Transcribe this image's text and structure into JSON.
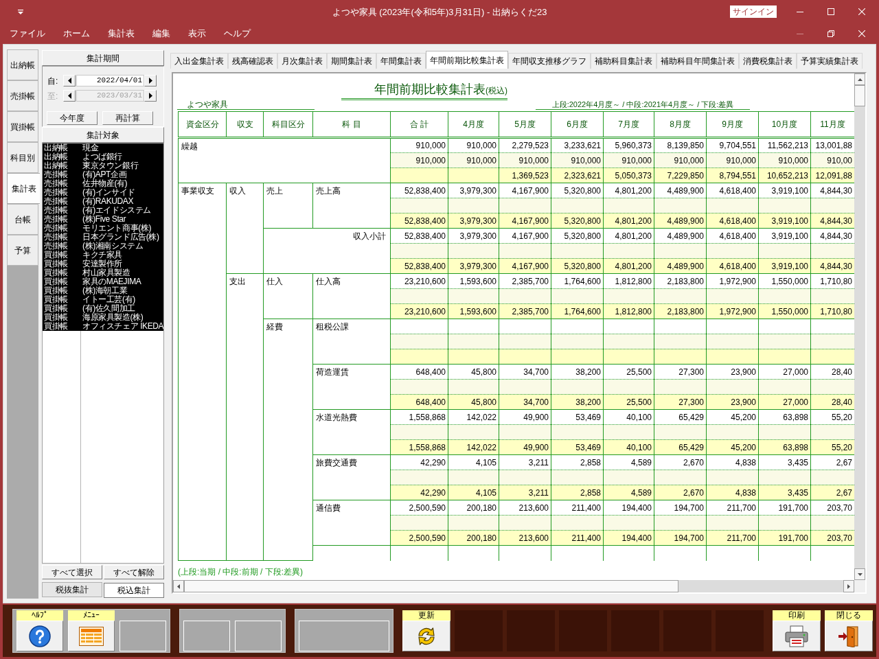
{
  "window": {
    "title": "よつや家具 (2023年(令和5年)3月31日) - 出納らくだ23",
    "signin": "サインイン"
  },
  "menu": [
    "ファイル",
    "ホーム",
    "集計表",
    "編集",
    "表示",
    "ヘルプ"
  ],
  "side_tabs": [
    {
      "label": "出納帳",
      "selected": false
    },
    {
      "label": "売掛帳",
      "selected": false
    },
    {
      "label": "買掛帳",
      "selected": false
    },
    {
      "label": "科目別",
      "selected": false
    },
    {
      "label": "集計表",
      "selected": true
    },
    {
      "label": "台帳",
      "selected": false
    },
    {
      "label": "予算",
      "selected": false
    }
  ],
  "period": {
    "header": "集計期間",
    "from": {
      "label": "自:",
      "value": "2022/04/01",
      "disabled": false
    },
    "to": {
      "label": "至:",
      "value": "2023/03/31",
      "disabled": true
    },
    "buttons": [
      "今年度",
      "再計算"
    ]
  },
  "targets": {
    "header": "集計対象",
    "items": [
      {
        "book": "出納帳",
        "name": "現金",
        "selected": true
      },
      {
        "book": "出納帳",
        "name": "よつば銀行",
        "selected": true
      },
      {
        "book": "出納帳",
        "name": "東京タウン銀行",
        "selected": true
      },
      {
        "book": "売掛帳",
        "name": "(有)APT企画",
        "selected": true
      },
      {
        "book": "売掛帳",
        "name": "佐井物産(有)",
        "selected": true
      },
      {
        "book": "売掛帳",
        "name": "(有)インサイド",
        "selected": true
      },
      {
        "book": "売掛帳",
        "name": "(有)RAKUDAX",
        "selected": true
      },
      {
        "book": "売掛帳",
        "name": "(有)エイドシステム",
        "selected": true
      },
      {
        "book": "売掛帳",
        "name": "(株)Five Star",
        "selected": true
      },
      {
        "book": "売掛帳",
        "name": "モリエント商事(株)",
        "selected": true
      },
      {
        "book": "売掛帳",
        "name": "日本グランド広告(株)",
        "selected": true
      },
      {
        "book": "売掛帳",
        "name": "(株)湘南システム",
        "selected": true
      },
      {
        "book": "買掛帳",
        "name": "キクチ家具",
        "selected": true
      },
      {
        "book": "買掛帳",
        "name": "安達製作所",
        "selected": true
      },
      {
        "book": "買掛帳",
        "name": "村山家具製造",
        "selected": true
      },
      {
        "book": "買掛帳",
        "name": "家具のMAEJIMA",
        "selected": true
      },
      {
        "book": "買掛帳",
        "name": "(株)海朝工業",
        "selected": true
      },
      {
        "book": "買掛帳",
        "name": "イトー工芸(有)",
        "selected": true
      },
      {
        "book": "買掛帳",
        "name": "(有)佐久間加工",
        "selected": true
      },
      {
        "book": "買掛帳",
        "name": "海原家具製造(株)",
        "selected": true
      },
      {
        "book": "買掛帳",
        "name": "オフィスチェア IKEDA",
        "selected": true
      }
    ],
    "buttons": [
      "すべて選択",
      "すべて解除"
    ]
  },
  "tax_modes": [
    {
      "label": "税抜集計",
      "selected": false
    },
    {
      "label": "税込集計",
      "selected": true
    }
  ],
  "tabs": [
    {
      "label": "入出金集計表",
      "selected": false
    },
    {
      "label": "残高確認表",
      "selected": false
    },
    {
      "label": "月次集計表",
      "selected": false
    },
    {
      "label": "期間集計表",
      "selected": false
    },
    {
      "label": "年間集計表",
      "selected": false
    },
    {
      "label": "年間前期比較集計表",
      "selected": true
    },
    {
      "label": "年間収支推移グラフ",
      "selected": false
    },
    {
      "label": "補助科目集計表",
      "selected": false
    },
    {
      "label": "補助科目年間集計表",
      "selected": false
    },
    {
      "label": "消費税集計表",
      "selected": false
    },
    {
      "label": "予算実績集計表",
      "selected": false
    }
  ],
  "report": {
    "title": "年間前期比較集計表",
    "title_note": "(税込)",
    "company": "よつや家具",
    "periods": "上段:2022年4月度～ / 中段:2021年4月度～ / 下段:差異",
    "columns": [
      "資金区分",
      "収支",
      "科目区分",
      "科 目",
      "合 計",
      "4月度",
      "5月度",
      "6月度",
      "7月度",
      "8月度",
      "9月度",
      "10月度",
      "11月度"
    ],
    "rows": [
      {
        "kind": "carryover",
        "account": "繰越",
        "cells": [
          {
            "current": "910,000",
            "previous": "910,000"
          },
          {
            "current": "910,000",
            "previous": "910,000"
          },
          {
            "current": "2,279,523",
            "previous": "910,000",
            "difference": "1,369,523"
          },
          {
            "current": "3,233,621",
            "previous": "910,000",
            "difference": "2,323,621"
          },
          {
            "current": "5,960,373",
            "previous": "910,000",
            "difference": "5,050,373"
          },
          {
            "current": "8,139,850",
            "previous": "910,000",
            "difference": "7,229,850"
          },
          {
            "current": "9,704,551",
            "previous": "910,000",
            "difference": "8,794,551"
          },
          {
            "current": "11,562,213",
            "previous": "910,000",
            "difference": "10,652,213"
          },
          {
            "current": "13,001,88",
            "previous": "910,00",
            "difference": "12,091,88"
          }
        ]
      },
      {
        "kind": "account",
        "fund": "事業収支",
        "flow": "収入",
        "category": "売上",
        "account": "売上高",
        "cells": [
          {
            "current": "52,838,400",
            "difference": "52,838,400"
          },
          {
            "current": "3,979,300",
            "difference": "3,979,300"
          },
          {
            "current": "4,167,900",
            "difference": "4,167,900"
          },
          {
            "current": "5,320,800",
            "difference": "5,320,800"
          },
          {
            "current": "4,801,200",
            "difference": "4,801,200"
          },
          {
            "current": "4,489,900",
            "difference": "4,489,900"
          },
          {
            "current": "4,618,400",
            "difference": "4,618,400"
          },
          {
            "current": "3,919,100",
            "difference": "3,919,100"
          },
          {
            "current": "4,844,30",
            "difference": "4,844,30"
          }
        ]
      },
      {
        "kind": "subtotal",
        "account": "収入小計",
        "cells": [
          {
            "current": "52,838,400",
            "difference": "52,838,400"
          },
          {
            "current": "3,979,300",
            "difference": "3,979,300"
          },
          {
            "current": "4,167,900",
            "difference": "4,167,900"
          },
          {
            "current": "5,320,800",
            "difference": "5,320,800"
          },
          {
            "current": "4,801,200",
            "difference": "4,801,200"
          },
          {
            "current": "4,489,900",
            "difference": "4,489,900"
          },
          {
            "current": "4,618,400",
            "difference": "4,618,400"
          },
          {
            "current": "3,919,100",
            "difference": "3,919,100"
          },
          {
            "current": "4,844,30",
            "difference": "4,844,30"
          }
        ]
      },
      {
        "kind": "account",
        "flow": "支出",
        "category": "仕入",
        "account": "仕入高",
        "cells": [
          {
            "current": "23,210,600",
            "difference": "23,210,600"
          },
          {
            "current": "1,593,600",
            "difference": "1,593,600"
          },
          {
            "current": "2,385,700",
            "difference": "2,385,700"
          },
          {
            "current": "1,764,600",
            "difference": "1,764,600"
          },
          {
            "current": "1,812,800",
            "difference": "1,812,800"
          },
          {
            "current": "2,183,800",
            "difference": "2,183,800"
          },
          {
            "current": "1,972,900",
            "difference": "1,972,900"
          },
          {
            "current": "1,550,000",
            "difference": "1,550,000"
          },
          {
            "current": "1,710,80",
            "difference": "1,710,80"
          }
        ]
      },
      {
        "kind": "account",
        "category": "経費",
        "account": "租税公課"
      },
      {
        "kind": "account",
        "account": "荷造運賃",
        "cells": [
          {
            "current": "648,400",
            "difference": "648,400"
          },
          {
            "current": "45,800",
            "difference": "45,800"
          },
          {
            "current": "34,700",
            "difference": "34,700"
          },
          {
            "current": "38,200",
            "difference": "38,200"
          },
          {
            "current": "25,500",
            "difference": "25,500"
          },
          {
            "current": "27,300",
            "difference": "27,300"
          },
          {
            "current": "23,900",
            "difference": "23,900"
          },
          {
            "current": "27,000",
            "difference": "27,000"
          },
          {
            "current": "28,40",
            "difference": "28,40"
          }
        ]
      },
      {
        "kind": "account",
        "account": "水道光熱費",
        "cells": [
          {
            "current": "1,558,868",
            "difference": "1,558,868"
          },
          {
            "current": "142,022",
            "difference": "142,022"
          },
          {
            "current": "49,900",
            "difference": "49,900"
          },
          {
            "current": "53,469",
            "difference": "53,469"
          },
          {
            "current": "40,100",
            "difference": "40,100"
          },
          {
            "current": "65,429",
            "difference": "65,429"
          },
          {
            "current": "45,200",
            "difference": "45,200"
          },
          {
            "current": "63,898",
            "difference": "63,898"
          },
          {
            "current": "55,20",
            "difference": "55,20"
          }
        ]
      },
      {
        "kind": "account",
        "account": "旅費交通費",
        "cells": [
          {
            "current": "42,290",
            "difference": "42,290"
          },
          {
            "current": "4,105",
            "difference": "4,105"
          },
          {
            "current": "3,211",
            "difference": "3,211"
          },
          {
            "current": "2,858",
            "difference": "2,858"
          },
          {
            "current": "4,589",
            "difference": "4,589"
          },
          {
            "current": "2,670",
            "difference": "2,670"
          },
          {
            "current": "4,838",
            "difference": "4,838"
          },
          {
            "current": "3,435",
            "difference": "3,435"
          },
          {
            "current": "2,67",
            "difference": "2,67"
          }
        ]
      },
      {
        "kind": "account",
        "account": "通信費",
        "cells": [
          {
            "current": "2,500,590",
            "difference": "2,500,590"
          },
          {
            "current": "200,180",
            "difference": "200,180"
          },
          {
            "current": "213,600",
            "difference": "213,600"
          },
          {
            "current": "211,400",
            "difference": "211,400"
          },
          {
            "current": "194,400",
            "difference": "194,400"
          },
          {
            "current": "194,700",
            "difference": "194,700"
          },
          {
            "current": "211,700",
            "difference": "211,700"
          },
          {
            "current": "191,700",
            "difference": "191,700"
          },
          {
            "current": "203,70",
            "difference": "203,70"
          }
        ]
      }
    ],
    "legend": "(上段:当期 / 中段:前期 / 下段:差異)"
  },
  "toolbar": [
    {
      "kind": "panel",
      "slots": [
        {
          "kind": "help",
          "label": "ﾍﾙﾌﾟ"
        },
        {
          "kind": "menu",
          "label": "ﾒﾆｭｰ"
        },
        {
          "kind": "empty"
        }
      ]
    },
    {
      "kind": "panel",
      "slots": [
        {
          "kind": "empty"
        },
        {
          "kind": "empty"
        }
      ]
    },
    {
      "kind": "panel",
      "slots": [
        {
          "kind": "empty",
          "wide": true
        }
      ]
    },
    {
      "kind": "bare",
      "slots": [
        {
          "kind": "refresh",
          "label": "更新"
        },
        {
          "kind": "empty"
        },
        {
          "kind": "empty"
        },
        {
          "kind": "empty"
        },
        {
          "kind": "empty"
        },
        {
          "kind": "empty"
        },
        {
          "kind": "empty"
        }
      ]
    },
    {
      "kind": "bare",
      "slots": [
        {
          "kind": "print",
          "label": "印刷"
        },
        {
          "kind": "exit",
          "label": "閉じる"
        }
      ]
    }
  ]
}
